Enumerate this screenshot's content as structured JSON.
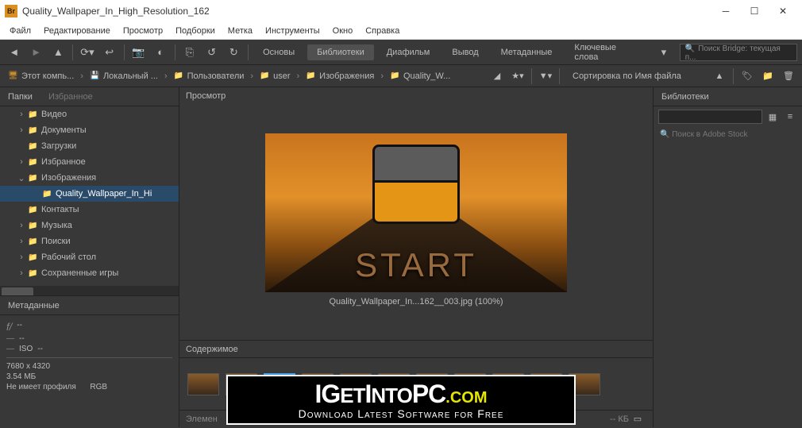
{
  "window": {
    "title": "Quality_Wallpaper_In_High_Resolution_162",
    "app_badge": "Br"
  },
  "menu": [
    "Файл",
    "Редактирование",
    "Просмотр",
    "Подборки",
    "Метка",
    "Инструменты",
    "Окно",
    "Справка"
  ],
  "toolbar_tabs": {
    "t1": "Основы",
    "t2": "Библиотеки",
    "t3": "Диафильм",
    "t4": "Вывод",
    "t5": "Метаданные",
    "t6": "Ключевые слова"
  },
  "search_placeholder": "Поиск Bridge: текущая п...",
  "crumbs": {
    "c1": "Этот компь...",
    "c2": "Локальный ...",
    "c3": "Пользователи",
    "c4": "user",
    "c5": "Изображения",
    "c6": "Quality_W..."
  },
  "sort_label": "Сортировка по Имя файла",
  "left_tabs": {
    "a": "Папки",
    "b": "Избранное"
  },
  "tree": {
    "n1": "Видео",
    "n2": "Документы",
    "n3": "Загрузки",
    "n4": "Избранное",
    "n5": "Изображения",
    "n5a": "Quality_Wallpaper_In_Hi",
    "n6": "Контакты",
    "n7": "Музыка",
    "n8": "Поиски",
    "n9": "Рабочий стол",
    "n10": "Сохраненные игры"
  },
  "meta_tab": "Метаданные",
  "meta": {
    "fstop_k": "f/",
    "fstop_v": "--",
    "shutter_v": "--",
    "iso_k": "ISO",
    "iso_v": "--",
    "dims": "7680 x 4320",
    "size": "3.54 МБ",
    "profile": "Не имеет профиля",
    "cs": "RGB"
  },
  "preview_tab": "Просмотр",
  "preview_caption": "Quality_Wallpaper_In...162__003.jpg (100%)",
  "start_text": "START",
  "content_tab": "Содержимое",
  "status_label": "Элемен",
  "status_size": "-- КБ",
  "right_tab": "Библиотеки",
  "right_search": "Поиск в Adobe Stock",
  "overlay": {
    "line1_pre": "IG",
    "line1_mid": "ET",
    "line1_pre2": "I",
    "line1_mid2": "NTO",
    "line1_big": "PC",
    "line1_y": ".COM",
    "line2": "Download Latest Software for Free"
  }
}
